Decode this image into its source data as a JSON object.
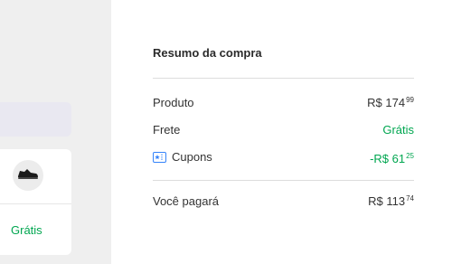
{
  "left": {
    "product_icon": "sneaker-icon",
    "shipping_label": "Grátis"
  },
  "summary": {
    "title": "Resumo da compra",
    "rows": [
      {
        "label": "Produto",
        "value_main": "R$ 174",
        "value_cents": "99"
      },
      {
        "label": "Frete",
        "value": "Grátis"
      },
      {
        "label": "Cupons",
        "icon": "coupon-icon",
        "value_main": "-R$ 61",
        "value_cents": "25"
      }
    ],
    "total": {
      "label": "Você pagará",
      "value_main": "R$ 113",
      "value_cents": "74"
    }
  },
  "colors": {
    "accent_green": "#00a650",
    "coupon_blue": "#3483fa",
    "left_bg": "#efefef"
  }
}
